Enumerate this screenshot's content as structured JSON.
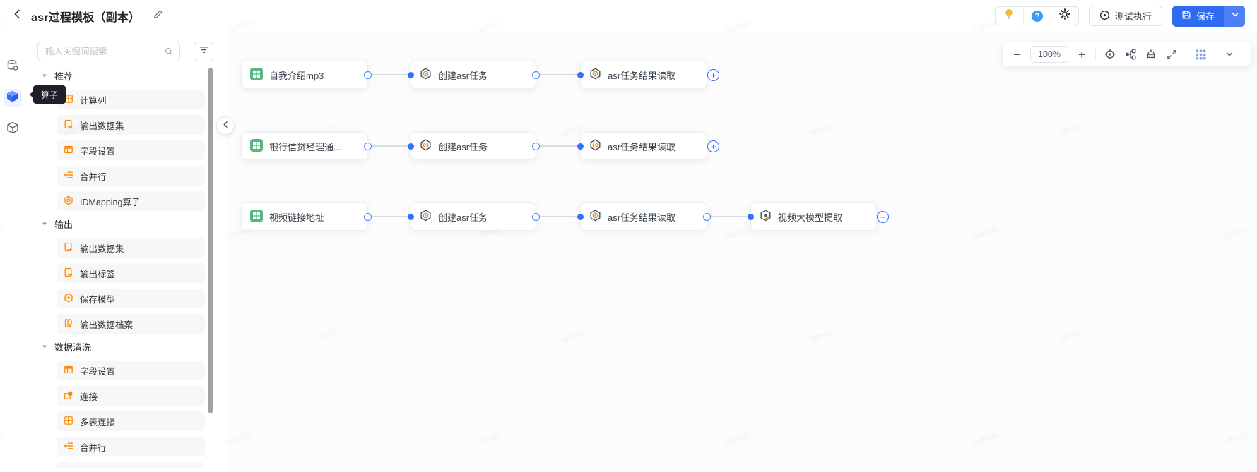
{
  "header": {
    "title": "asr过程模板（副本）",
    "test_run_label": "测试执行",
    "save_label": "保存",
    "help_glyph": "?"
  },
  "rail": {
    "tooltip": "算子"
  },
  "sidebar": {
    "search_placeholder": "输入关键词搜索",
    "sections": [
      {
        "label": "推荐",
        "items": [
          {
            "label": "计算列",
            "icon": "calc-column-icon"
          },
          {
            "label": "输出数据集",
            "icon": "output-dataset-icon"
          },
          {
            "label": "字段设置",
            "icon": "field-settings-icon"
          },
          {
            "label": "合并行",
            "icon": "merge-rows-icon"
          },
          {
            "label": "IDMapping算子",
            "icon": "idmapping-icon"
          }
        ]
      },
      {
        "label": "输出",
        "items": [
          {
            "label": "输出数据集",
            "icon": "output-dataset-icon"
          },
          {
            "label": "输出标签",
            "icon": "output-label-icon"
          },
          {
            "label": "保存模型",
            "icon": "save-model-icon"
          },
          {
            "label": "输出数据档案",
            "icon": "output-archive-icon"
          }
        ]
      },
      {
        "label": "数据清洗",
        "items": [
          {
            "label": "字段设置",
            "icon": "field-settings-icon"
          },
          {
            "label": "连接",
            "icon": "join-icon"
          },
          {
            "label": "多表连接",
            "icon": "multi-join-icon"
          },
          {
            "label": "合并行",
            "icon": "merge-rows-icon"
          }
        ]
      }
    ]
  },
  "canvas": {
    "watermark": "admin",
    "zoom_level": "100%",
    "rows": [
      {
        "nodes": [
          {
            "label": "自我介绍mp3",
            "type": "dataset"
          },
          {
            "label": "创建asr任务",
            "type": "operator"
          },
          {
            "label": "asr任务结果读取",
            "type": "operator"
          }
        ]
      },
      {
        "nodes": [
          {
            "label": "银行信贷经理通...",
            "type": "dataset"
          },
          {
            "label": "创建asr任务",
            "type": "operator"
          },
          {
            "label": "asr任务结果读取",
            "type": "operator"
          }
        ]
      },
      {
        "nodes": [
          {
            "label": "视频链接地址",
            "type": "dataset"
          },
          {
            "label": "创建asr任务",
            "type": "operator"
          },
          {
            "label": "asr任务结果读取",
            "type": "operator"
          },
          {
            "label": "视频大模型提取",
            "type": "model"
          }
        ]
      }
    ]
  },
  "colors": {
    "accent": "#3370ff",
    "icon_orange": "#ff8800",
    "dataset_green": "#56b87f"
  }
}
